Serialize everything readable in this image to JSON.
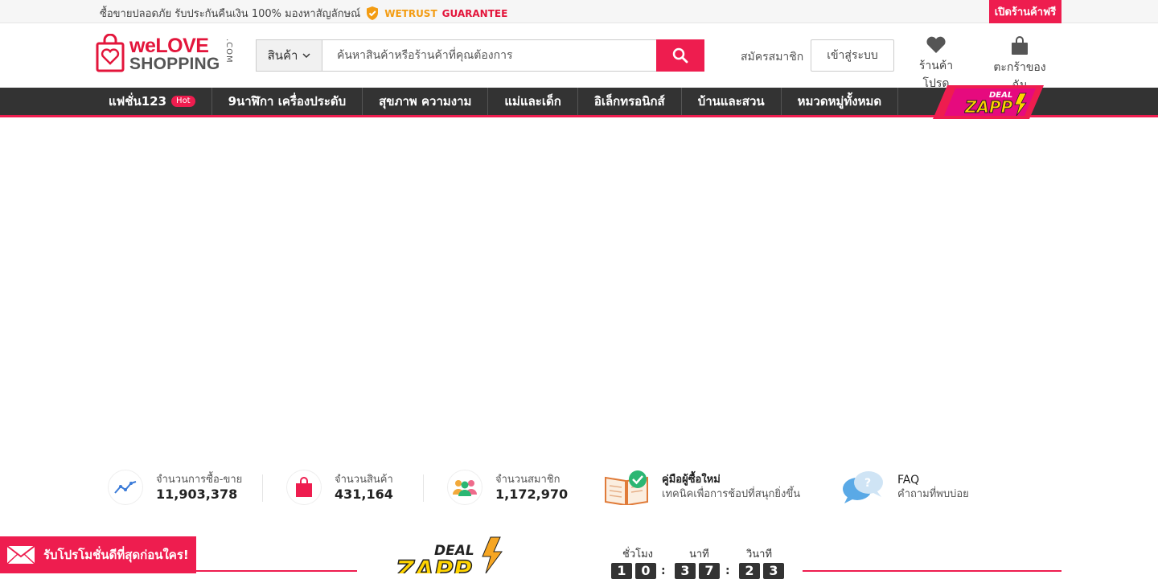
{
  "topbar": {
    "trust_text": "ซื้อขายปลอดภัย รับประกันคืนเงิน 100% มองหาสัญลักษณ์",
    "wetrust": "WETRUST",
    "guarantee": "GUARANTEE",
    "open_shop": "เปิดร้านค้าฟรี"
  },
  "logo": {
    "line1_we": "we",
    "line1_love": "LOVE",
    "line2": "SHOPPING",
    "com": ".COM"
  },
  "search": {
    "category": "สินค้า",
    "placeholder": "ค้นหาสินค้าหรือร้านค้าที่คุณต้องการ"
  },
  "account": {
    "register": "สมัครสมาชิก",
    "login": "เข้าสู่ระบบ",
    "favorites": "ร้านค้าโปรด",
    "cart": "ตะกร้าของฉัน"
  },
  "nav": {
    "items": [
      {
        "label": "แฟชั่น123",
        "badge": "Hot"
      },
      {
        "label": "9นาฬิกา เครื่องประดับ"
      },
      {
        "label": "สุขภาพ ความงาม"
      },
      {
        "label": "แม่และเด็ก"
      },
      {
        "label": "อิเล็กทรอนิกส์"
      },
      {
        "label": "บ้านและสวน"
      },
      {
        "label": "หมวดหมู่ทั้งหมด"
      }
    ],
    "deal_logo": {
      "line1": "DEAL",
      "line2": "ZAPP"
    }
  },
  "stats": [
    {
      "label": "จำนวนการซื้อ-ขาย",
      "value": "11,903,378",
      "icon": "chart-line-icon"
    },
    {
      "label": "จำนวนสินค้า",
      "value": "431,164",
      "icon": "shopping-bag-icon"
    },
    {
      "label": "จำนวนสมาชิก",
      "value": "1,172,970",
      "icon": "members-icon"
    },
    {
      "label": "คู่มือผู้ซื้อใหม่",
      "value": "เทคนิคเพื่อการช้อปที่สนุกยิ่งขึ้น",
      "icon": "guide-book-icon"
    },
    {
      "label": "FAQ",
      "value": "คำถามที่พบบ่อย",
      "icon": "faq-bubble-icon"
    }
  ],
  "promo": {
    "label": "รับโปรโมชั่นดีที่สุดก่อนใคร!"
  },
  "countdown": {
    "hours_label": "ชั่วโมง",
    "minutes_label": "นาที",
    "seconds_label": "วินาที",
    "hours": [
      "1",
      "0"
    ],
    "minutes": [
      "3",
      "7"
    ],
    "seconds": [
      "2",
      "3"
    ]
  },
  "colors": {
    "brand": "#ee1d4f",
    "nav_bg": "#333333",
    "trust_orange": "#f39c12"
  }
}
